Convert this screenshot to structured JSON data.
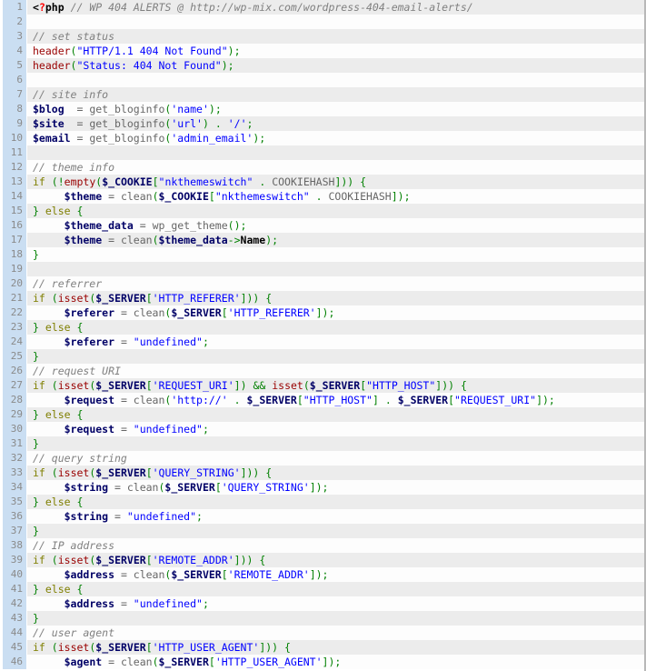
{
  "viewer": {
    "language": "php",
    "title": "WP 404 ALERTS code listing",
    "first_line": 1,
    "last_line": 46,
    "total_visible_lines": 46,
    "colors": {
      "gutter_bg": "#cadef2",
      "gutter_text": "#8a8a8a",
      "row_odd_bg": "#ececec",
      "row_even_bg": "#fdfdfd",
      "plain": "#666666",
      "comment": "#808080",
      "keyword": "#7f7f00",
      "function": "#990000",
      "string": "#0000ff",
      "variable": "#000066",
      "punctuation": "#008000",
      "tag": "#000000",
      "tag_question": "#ff0000"
    }
  },
  "lines": [
    {
      "n": 1,
      "tokens": [
        {
          "t": "tag",
          "v": "<"
        },
        {
          "t": "tagq",
          "v": "?"
        },
        {
          "t": "tag",
          "v": "php"
        },
        {
          "t": "plain",
          "v": " "
        },
        {
          "t": "comment",
          "v": "// WP 404 ALERTS @ http://wp-mix.com/wordpress-404-email-alerts/"
        }
      ]
    },
    {
      "n": 2,
      "tokens": []
    },
    {
      "n": 3,
      "tokens": [
        {
          "t": "comment",
          "v": "// set status"
        }
      ]
    },
    {
      "n": 4,
      "tokens": [
        {
          "t": "fn",
          "v": "header"
        },
        {
          "t": "punc",
          "v": "("
        },
        {
          "t": "str",
          "v": "\"HTTP/1.1 404 Not Found\""
        },
        {
          "t": "punc",
          "v": ")"
        },
        {
          "t": "punc",
          "v": ";"
        }
      ]
    },
    {
      "n": 5,
      "tokens": [
        {
          "t": "fn",
          "v": "header"
        },
        {
          "t": "punc",
          "v": "("
        },
        {
          "t": "str",
          "v": "\"Status: 404 Not Found\""
        },
        {
          "t": "punc",
          "v": ")"
        },
        {
          "t": "punc",
          "v": ";"
        }
      ]
    },
    {
      "n": 6,
      "tokens": []
    },
    {
      "n": 7,
      "tokens": [
        {
          "t": "comment",
          "v": "// site info"
        }
      ]
    },
    {
      "n": 8,
      "tokens": [
        {
          "t": "var",
          "v": "$blog"
        },
        {
          "t": "plain",
          "v": "  = get_bloginfo"
        },
        {
          "t": "punc",
          "v": "("
        },
        {
          "t": "str",
          "v": "'name'"
        },
        {
          "t": "punc",
          "v": ")"
        },
        {
          "t": "punc",
          "v": ";"
        }
      ]
    },
    {
      "n": 9,
      "tokens": [
        {
          "t": "var",
          "v": "$site"
        },
        {
          "t": "plain",
          "v": "  = get_bloginfo"
        },
        {
          "t": "punc",
          "v": "("
        },
        {
          "t": "str",
          "v": "'url'"
        },
        {
          "t": "punc",
          "v": ")"
        },
        {
          "t": "plain",
          "v": " "
        },
        {
          "t": "punc",
          "v": "."
        },
        {
          "t": "plain",
          "v": " "
        },
        {
          "t": "str",
          "v": "'/'"
        },
        {
          "t": "punc",
          "v": ";"
        }
      ]
    },
    {
      "n": 10,
      "tokens": [
        {
          "t": "var",
          "v": "$email"
        },
        {
          "t": "plain",
          "v": " = get_bloginfo"
        },
        {
          "t": "punc",
          "v": "("
        },
        {
          "t": "str",
          "v": "'admin_email'"
        },
        {
          "t": "punc",
          "v": ")"
        },
        {
          "t": "punc",
          "v": ";"
        }
      ]
    },
    {
      "n": 11,
      "tokens": []
    },
    {
      "n": 12,
      "tokens": [
        {
          "t": "comment",
          "v": "// theme info"
        }
      ]
    },
    {
      "n": 13,
      "tokens": [
        {
          "t": "kw",
          "v": "if"
        },
        {
          "t": "plain",
          "v": " "
        },
        {
          "t": "punc",
          "v": "(!"
        },
        {
          "t": "fn",
          "v": "empty"
        },
        {
          "t": "punc",
          "v": "("
        },
        {
          "t": "var",
          "v": "$_COOKIE"
        },
        {
          "t": "punc",
          "v": "["
        },
        {
          "t": "str",
          "v": "\"nkthemeswitch\""
        },
        {
          "t": "plain",
          "v": " "
        },
        {
          "t": "punc",
          "v": "."
        },
        {
          "t": "plain",
          "v": " COOKIEHASH"
        },
        {
          "t": "punc",
          "v": "]))"
        },
        {
          "t": "plain",
          "v": " "
        },
        {
          "t": "punc",
          "v": "{"
        }
      ]
    },
    {
      "n": 14,
      "tokens": [
        {
          "t": "plain",
          "v": "     "
        },
        {
          "t": "var",
          "v": "$theme"
        },
        {
          "t": "plain",
          "v": " = clean"
        },
        {
          "t": "punc",
          "v": "("
        },
        {
          "t": "var",
          "v": "$_COOKIE"
        },
        {
          "t": "punc",
          "v": "["
        },
        {
          "t": "str",
          "v": "\"nkthemeswitch\""
        },
        {
          "t": "plain",
          "v": " "
        },
        {
          "t": "punc",
          "v": "."
        },
        {
          "t": "plain",
          "v": " COOKIEHASH"
        },
        {
          "t": "punc",
          "v": "])"
        },
        {
          "t": "punc",
          "v": ";"
        }
      ]
    },
    {
      "n": 15,
      "tokens": [
        {
          "t": "punc",
          "v": "}"
        },
        {
          "t": "plain",
          "v": " "
        },
        {
          "t": "kw",
          "v": "else"
        },
        {
          "t": "plain",
          "v": " "
        },
        {
          "t": "punc",
          "v": "{"
        }
      ]
    },
    {
      "n": 16,
      "tokens": [
        {
          "t": "plain",
          "v": "     "
        },
        {
          "t": "var",
          "v": "$theme_data"
        },
        {
          "t": "plain",
          "v": " = wp_get_theme"
        },
        {
          "t": "punc",
          "v": "()"
        },
        {
          "t": "punc",
          "v": ";"
        }
      ]
    },
    {
      "n": 17,
      "tokens": [
        {
          "t": "plain",
          "v": "     "
        },
        {
          "t": "var",
          "v": "$theme"
        },
        {
          "t": "plain",
          "v": " = clean"
        },
        {
          "t": "punc",
          "v": "("
        },
        {
          "t": "var",
          "v": "$theme_data"
        },
        {
          "t": "punc",
          "v": "->"
        },
        {
          "t": "tag",
          "v": "Name"
        },
        {
          "t": "punc",
          "v": ")"
        },
        {
          "t": "punc",
          "v": ";"
        }
      ]
    },
    {
      "n": 18,
      "tokens": [
        {
          "t": "punc",
          "v": "}"
        }
      ]
    },
    {
      "n": 19,
      "tokens": []
    },
    {
      "n": 20,
      "tokens": [
        {
          "t": "comment",
          "v": "// referrer"
        }
      ]
    },
    {
      "n": 21,
      "tokens": [
        {
          "t": "kw",
          "v": "if"
        },
        {
          "t": "plain",
          "v": " "
        },
        {
          "t": "punc",
          "v": "("
        },
        {
          "t": "fn",
          "v": "isset"
        },
        {
          "t": "punc",
          "v": "("
        },
        {
          "t": "var",
          "v": "$_SERVER"
        },
        {
          "t": "punc",
          "v": "["
        },
        {
          "t": "str",
          "v": "'HTTP_REFERER'"
        },
        {
          "t": "punc",
          "v": "]))"
        },
        {
          "t": "plain",
          "v": " "
        },
        {
          "t": "punc",
          "v": "{"
        }
      ]
    },
    {
      "n": 22,
      "tokens": [
        {
          "t": "plain",
          "v": "     "
        },
        {
          "t": "var",
          "v": "$referer"
        },
        {
          "t": "plain",
          "v": " = clean"
        },
        {
          "t": "punc",
          "v": "("
        },
        {
          "t": "var",
          "v": "$_SERVER"
        },
        {
          "t": "punc",
          "v": "["
        },
        {
          "t": "str",
          "v": "'HTTP_REFERER'"
        },
        {
          "t": "punc",
          "v": "])"
        },
        {
          "t": "punc",
          "v": ";"
        }
      ]
    },
    {
      "n": 23,
      "tokens": [
        {
          "t": "punc",
          "v": "}"
        },
        {
          "t": "plain",
          "v": " "
        },
        {
          "t": "kw",
          "v": "else"
        },
        {
          "t": "plain",
          "v": " "
        },
        {
          "t": "punc",
          "v": "{"
        }
      ]
    },
    {
      "n": 24,
      "tokens": [
        {
          "t": "plain",
          "v": "     "
        },
        {
          "t": "var",
          "v": "$referer"
        },
        {
          "t": "plain",
          "v": " = "
        },
        {
          "t": "str",
          "v": "\"undefined\""
        },
        {
          "t": "punc",
          "v": ";"
        }
      ]
    },
    {
      "n": 25,
      "tokens": [
        {
          "t": "punc",
          "v": "}"
        }
      ]
    },
    {
      "n": 26,
      "tokens": [
        {
          "t": "comment",
          "v": "// request URI"
        }
      ]
    },
    {
      "n": 27,
      "tokens": [
        {
          "t": "kw",
          "v": "if"
        },
        {
          "t": "plain",
          "v": " "
        },
        {
          "t": "punc",
          "v": "("
        },
        {
          "t": "fn",
          "v": "isset"
        },
        {
          "t": "punc",
          "v": "("
        },
        {
          "t": "var",
          "v": "$_SERVER"
        },
        {
          "t": "punc",
          "v": "["
        },
        {
          "t": "str",
          "v": "'REQUEST_URI'"
        },
        {
          "t": "punc",
          "v": "])"
        },
        {
          "t": "plain",
          "v": " "
        },
        {
          "t": "punc",
          "v": "&&"
        },
        {
          "t": "plain",
          "v": " "
        },
        {
          "t": "fn",
          "v": "isset"
        },
        {
          "t": "punc",
          "v": "("
        },
        {
          "t": "var",
          "v": "$_SERVER"
        },
        {
          "t": "punc",
          "v": "["
        },
        {
          "t": "str",
          "v": "\"HTTP_HOST\""
        },
        {
          "t": "punc",
          "v": "]))"
        },
        {
          "t": "plain",
          "v": " "
        },
        {
          "t": "punc",
          "v": "{"
        }
      ]
    },
    {
      "n": 28,
      "tokens": [
        {
          "t": "plain",
          "v": "     "
        },
        {
          "t": "var",
          "v": "$request"
        },
        {
          "t": "plain",
          "v": " = clean"
        },
        {
          "t": "punc",
          "v": "("
        },
        {
          "t": "str",
          "v": "'http://'"
        },
        {
          "t": "plain",
          "v": " "
        },
        {
          "t": "punc",
          "v": "."
        },
        {
          "t": "plain",
          "v": " "
        },
        {
          "t": "var",
          "v": "$_SERVER"
        },
        {
          "t": "punc",
          "v": "["
        },
        {
          "t": "str",
          "v": "\"HTTP_HOST\""
        },
        {
          "t": "punc",
          "v": "]"
        },
        {
          "t": "plain",
          "v": " "
        },
        {
          "t": "punc",
          "v": "."
        },
        {
          "t": "plain",
          "v": " "
        },
        {
          "t": "var",
          "v": "$_SERVER"
        },
        {
          "t": "punc",
          "v": "["
        },
        {
          "t": "str",
          "v": "\"REQUEST_URI\""
        },
        {
          "t": "punc",
          "v": "])"
        },
        {
          "t": "punc",
          "v": ";"
        }
      ]
    },
    {
      "n": 29,
      "tokens": [
        {
          "t": "punc",
          "v": "}"
        },
        {
          "t": "plain",
          "v": " "
        },
        {
          "t": "kw",
          "v": "else"
        },
        {
          "t": "plain",
          "v": " "
        },
        {
          "t": "punc",
          "v": "{"
        }
      ]
    },
    {
      "n": 30,
      "tokens": [
        {
          "t": "plain",
          "v": "     "
        },
        {
          "t": "var",
          "v": "$request"
        },
        {
          "t": "plain",
          "v": " = "
        },
        {
          "t": "str",
          "v": "\"undefined\""
        },
        {
          "t": "punc",
          "v": ";"
        }
      ]
    },
    {
      "n": 31,
      "tokens": [
        {
          "t": "punc",
          "v": "}"
        }
      ]
    },
    {
      "n": 32,
      "tokens": [
        {
          "t": "comment",
          "v": "// query string"
        }
      ]
    },
    {
      "n": 33,
      "tokens": [
        {
          "t": "kw",
          "v": "if"
        },
        {
          "t": "plain",
          "v": " "
        },
        {
          "t": "punc",
          "v": "("
        },
        {
          "t": "fn",
          "v": "isset"
        },
        {
          "t": "punc",
          "v": "("
        },
        {
          "t": "var",
          "v": "$_SERVER"
        },
        {
          "t": "punc",
          "v": "["
        },
        {
          "t": "str",
          "v": "'QUERY_STRING'"
        },
        {
          "t": "punc",
          "v": "]))"
        },
        {
          "t": "plain",
          "v": " "
        },
        {
          "t": "punc",
          "v": "{"
        }
      ]
    },
    {
      "n": 34,
      "tokens": [
        {
          "t": "plain",
          "v": "     "
        },
        {
          "t": "var",
          "v": "$string"
        },
        {
          "t": "plain",
          "v": " = clean"
        },
        {
          "t": "punc",
          "v": "("
        },
        {
          "t": "var",
          "v": "$_SERVER"
        },
        {
          "t": "punc",
          "v": "["
        },
        {
          "t": "str",
          "v": "'QUERY_STRING'"
        },
        {
          "t": "punc",
          "v": "])"
        },
        {
          "t": "punc",
          "v": ";"
        }
      ]
    },
    {
      "n": 35,
      "tokens": [
        {
          "t": "punc",
          "v": "}"
        },
        {
          "t": "plain",
          "v": " "
        },
        {
          "t": "kw",
          "v": "else"
        },
        {
          "t": "plain",
          "v": " "
        },
        {
          "t": "punc",
          "v": "{"
        }
      ]
    },
    {
      "n": 36,
      "tokens": [
        {
          "t": "plain",
          "v": "     "
        },
        {
          "t": "var",
          "v": "$string"
        },
        {
          "t": "plain",
          "v": " = "
        },
        {
          "t": "str",
          "v": "\"undefined\""
        },
        {
          "t": "punc",
          "v": ";"
        }
      ]
    },
    {
      "n": 37,
      "tokens": [
        {
          "t": "punc",
          "v": "}"
        }
      ]
    },
    {
      "n": 38,
      "tokens": [
        {
          "t": "comment",
          "v": "// IP address"
        }
      ]
    },
    {
      "n": 39,
      "tokens": [
        {
          "t": "kw",
          "v": "if"
        },
        {
          "t": "plain",
          "v": " "
        },
        {
          "t": "punc",
          "v": "("
        },
        {
          "t": "fn",
          "v": "isset"
        },
        {
          "t": "punc",
          "v": "("
        },
        {
          "t": "var",
          "v": "$_SERVER"
        },
        {
          "t": "punc",
          "v": "["
        },
        {
          "t": "str",
          "v": "'REMOTE_ADDR'"
        },
        {
          "t": "punc",
          "v": "]))"
        },
        {
          "t": "plain",
          "v": " "
        },
        {
          "t": "punc",
          "v": "{"
        }
      ]
    },
    {
      "n": 40,
      "tokens": [
        {
          "t": "plain",
          "v": "     "
        },
        {
          "t": "var",
          "v": "$address"
        },
        {
          "t": "plain",
          "v": " = clean"
        },
        {
          "t": "punc",
          "v": "("
        },
        {
          "t": "var",
          "v": "$_SERVER"
        },
        {
          "t": "punc",
          "v": "["
        },
        {
          "t": "str",
          "v": "'REMOTE_ADDR'"
        },
        {
          "t": "punc",
          "v": "])"
        },
        {
          "t": "punc",
          "v": ";"
        }
      ]
    },
    {
      "n": 41,
      "tokens": [
        {
          "t": "punc",
          "v": "}"
        },
        {
          "t": "plain",
          "v": " "
        },
        {
          "t": "kw",
          "v": "else"
        },
        {
          "t": "plain",
          "v": " "
        },
        {
          "t": "punc",
          "v": "{"
        }
      ]
    },
    {
      "n": 42,
      "tokens": [
        {
          "t": "plain",
          "v": "     "
        },
        {
          "t": "var",
          "v": "$address"
        },
        {
          "t": "plain",
          "v": " = "
        },
        {
          "t": "str",
          "v": "\"undefined\""
        },
        {
          "t": "punc",
          "v": ";"
        }
      ]
    },
    {
      "n": 43,
      "tokens": [
        {
          "t": "punc",
          "v": "}"
        }
      ]
    },
    {
      "n": 44,
      "tokens": [
        {
          "t": "comment",
          "v": "// user agent"
        }
      ]
    },
    {
      "n": 45,
      "tokens": [
        {
          "t": "kw",
          "v": "if"
        },
        {
          "t": "plain",
          "v": " "
        },
        {
          "t": "punc",
          "v": "("
        },
        {
          "t": "fn",
          "v": "isset"
        },
        {
          "t": "punc",
          "v": "("
        },
        {
          "t": "var",
          "v": "$_SERVER"
        },
        {
          "t": "punc",
          "v": "["
        },
        {
          "t": "str",
          "v": "'HTTP_USER_AGENT'"
        },
        {
          "t": "punc",
          "v": "]))"
        },
        {
          "t": "plain",
          "v": " "
        },
        {
          "t": "punc",
          "v": "{"
        }
      ]
    },
    {
      "n": 46,
      "tokens": [
        {
          "t": "plain",
          "v": "     "
        },
        {
          "t": "var",
          "v": "$agent"
        },
        {
          "t": "plain",
          "v": " = clean"
        },
        {
          "t": "punc",
          "v": "("
        },
        {
          "t": "var",
          "v": "$_SERVER"
        },
        {
          "t": "punc",
          "v": "["
        },
        {
          "t": "str",
          "v": "'HTTP_USER_AGENT'"
        },
        {
          "t": "punc",
          "v": "])"
        },
        {
          "t": "punc",
          "v": ";"
        }
      ]
    }
  ]
}
